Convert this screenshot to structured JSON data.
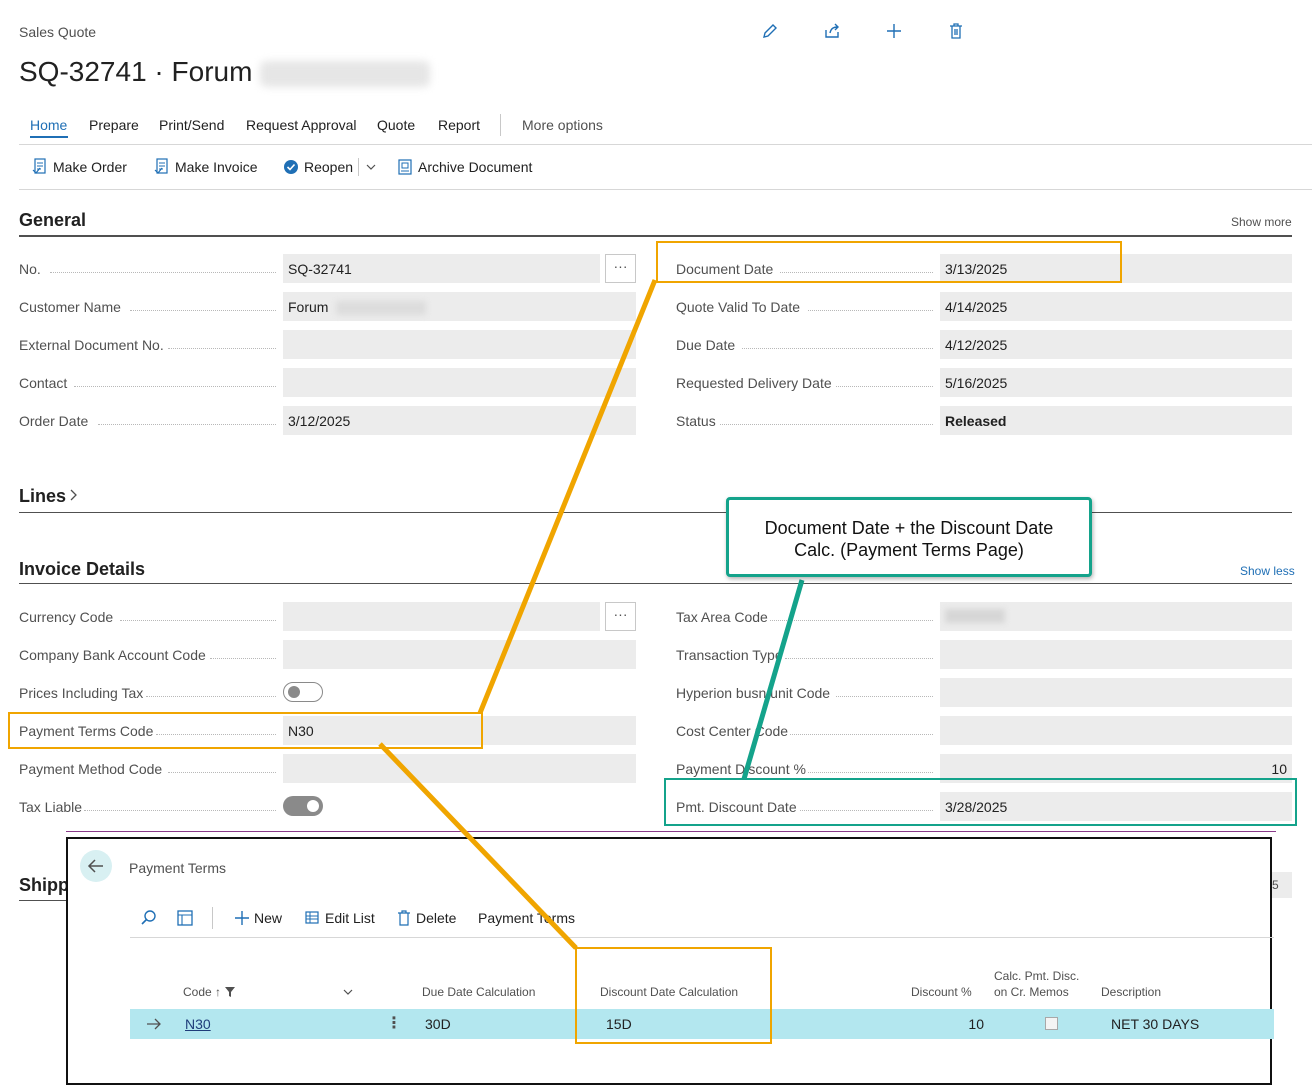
{
  "header": {
    "breadcrumb": "Sales Quote",
    "title": "SQ-32741 · Forum"
  },
  "top_icons": [
    "edit-icon",
    "share-icon",
    "add-icon",
    "delete-icon"
  ],
  "tabs": [
    {
      "label": "Home",
      "active": true
    },
    {
      "label": "Prepare"
    },
    {
      "label": "Print/Send"
    },
    {
      "label": "Request Approval"
    },
    {
      "label": "Quote"
    },
    {
      "label": "Report"
    }
  ],
  "more_options": "More options",
  "actions": [
    {
      "label": "Make Order",
      "icon": "make-order-icon"
    },
    {
      "label": "Make Invoice",
      "icon": "make-invoice-icon"
    },
    {
      "label": "Reopen",
      "icon": "reopen-icon"
    },
    {
      "label": "Archive Document",
      "icon": "archive-icon"
    }
  ],
  "general": {
    "title": "General",
    "show_more": "Show more",
    "left_fields": [
      {
        "label": "No.",
        "value": "SQ-32741"
      },
      {
        "label": "Customer Name",
        "value": "Forum"
      },
      {
        "label": "External Document No.",
        "value": ""
      },
      {
        "label": "Contact",
        "value": ""
      },
      {
        "label": "Order Date",
        "value": "3/12/2025"
      }
    ],
    "right_fields": [
      {
        "label": "Document Date",
        "value": "3/13/2025"
      },
      {
        "label": "Quote Valid To Date",
        "value": "4/14/2025"
      },
      {
        "label": "Due Date",
        "value": "4/12/2025"
      },
      {
        "label": "Requested Delivery Date",
        "value": "5/16/2025"
      },
      {
        "label": "Status",
        "value": "Released"
      }
    ]
  },
  "lines": {
    "title": "Lines"
  },
  "invoice": {
    "title": "Invoice Details",
    "show_less": "Show less",
    "left_fields": [
      {
        "label": "Currency Code",
        "value": ""
      },
      {
        "label": "Company Bank Account Code",
        "value": ""
      },
      {
        "label": "Prices Including Tax",
        "value": "off"
      },
      {
        "label": "Payment Terms Code",
        "value": "N30"
      },
      {
        "label": "Payment Method Code",
        "value": ""
      },
      {
        "label": "Tax Liable",
        "value": "on"
      }
    ],
    "right_fields": [
      {
        "label": "Tax Area Code",
        "value": ""
      },
      {
        "label": "Transaction Type",
        "value": ""
      },
      {
        "label": "Hyperion busn unit Code",
        "value": ""
      },
      {
        "label": "Cost Center Code",
        "value": ""
      },
      {
        "label": "Payment Discount %",
        "value": "10"
      },
      {
        "label": "Pmt. Discount Date",
        "value": "3/28/2025"
      }
    ]
  },
  "shipping": {
    "title": "Shipp"
  },
  "callout": {
    "line1": "Document Date + the Discount Date",
    "line2": "Calc. (Payment Terms Page)"
  },
  "payment_terms": {
    "title": "Payment Terms",
    "toolbar": {
      "new": "New",
      "edit_list": "Edit List",
      "delete": "Delete",
      "payment_terms": "Payment Terms"
    },
    "columns": {
      "code": "Code ↑",
      "due_date_calc": "Due Date Calculation",
      "discount_date_calc": "Discount Date Calculation",
      "discount_pct": "Discount %",
      "calc_pmt_disc_1": "Calc. Pmt. Disc.",
      "calc_pmt_disc_2": "on Cr. Memos",
      "description": "Description"
    },
    "row": {
      "code": "N30",
      "due_date_calc": "30D",
      "discount_date_calc": "15D",
      "discount_pct": "10",
      "calc_pmt_disc": false,
      "description": "NET 30 DAYS"
    }
  },
  "colors": {
    "accent": "#1f6fb5",
    "orange": "#f0a500",
    "teal": "#14a38b",
    "row_highlight": "#b3e7ef"
  }
}
